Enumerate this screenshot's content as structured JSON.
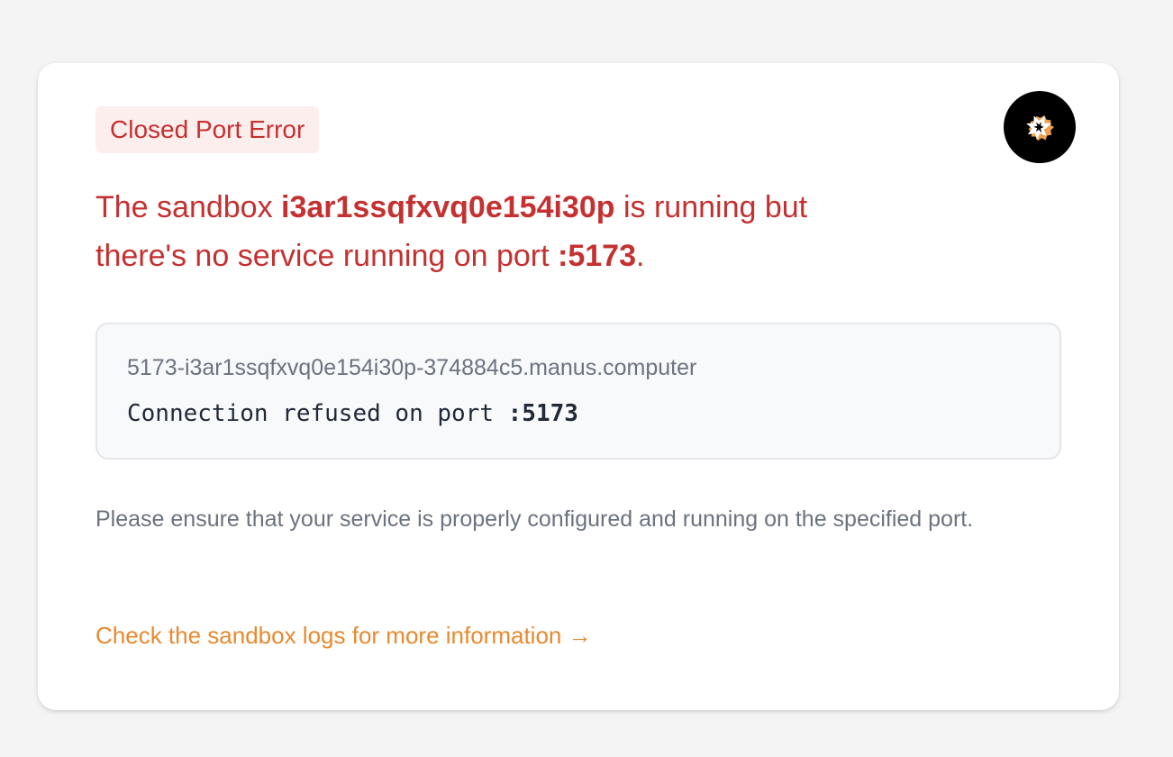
{
  "badge": {
    "label": "Closed Port Error"
  },
  "headline": {
    "part1": "The sandbox ",
    "sandbox_id": "i3ar1ssqfxvq0e154i30p",
    "part2": " is running but there's no service running on port ",
    "port": ":5173",
    "part3": "."
  },
  "details": {
    "url": "5173-i3ar1ssqfxvq0e154i30p-374884c5.manus.computer",
    "message": "Connection refused on port ",
    "port": ":5173"
  },
  "note": {
    "text": "Please ensure that your service is properly configured and running on the specified port."
  },
  "link": {
    "label": "Check the sandbox logs for more information →"
  },
  "logo": {
    "icon": "manus-logo-icon"
  },
  "colors": {
    "error": "#c53030",
    "error_bg": "#fdeeee",
    "link": "#e8892e",
    "muted": "#6b7280",
    "page_bg": "#f4f4f4"
  }
}
